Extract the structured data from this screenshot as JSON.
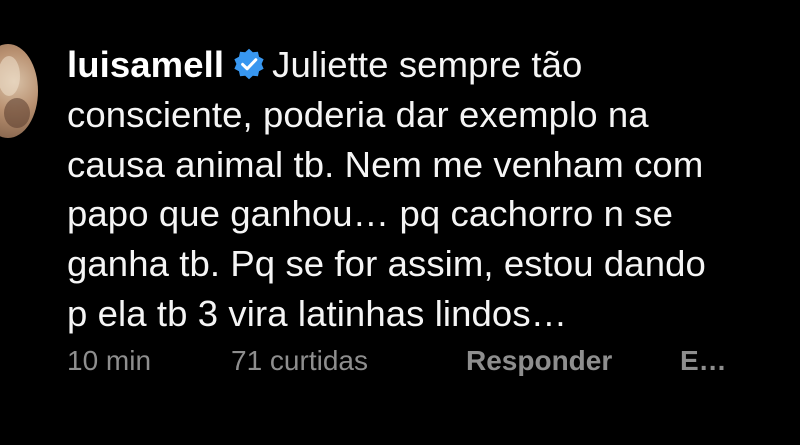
{
  "comment": {
    "username": "luisamell",
    "verified_icon": "verified-badge-icon",
    "verified_color": "#3897f0",
    "lines": [
      "Juliette sempre tão",
      "consciente, poderia dar exemplo na",
      "causa animal tb. Nem me venham com",
      "papo que ganhou… pq cachorro n se",
      "ganha tb. Pq se for assim, estou dando",
      "p ela tb 3 vira latinhas lindos…"
    ],
    "meta": {
      "time": "10 min",
      "likes": "71 curtidas",
      "reply": "Responder",
      "more": "E…"
    }
  },
  "colors": {
    "background": "#000000",
    "text": "#f5f5f5",
    "meta_text": "#8e8e8e"
  }
}
